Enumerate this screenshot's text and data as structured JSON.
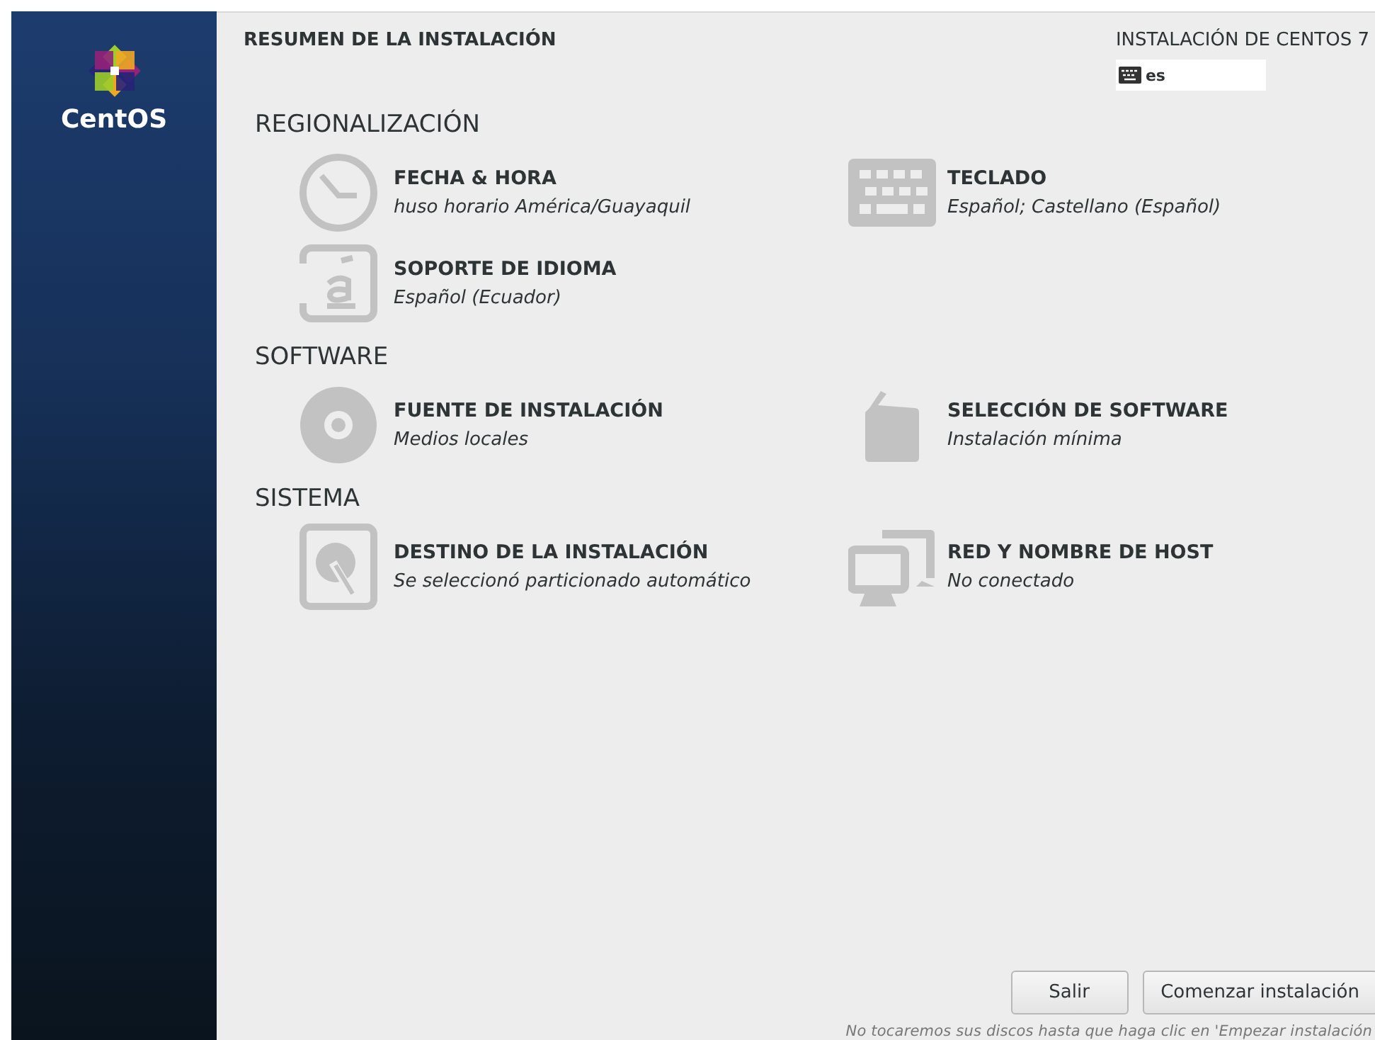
{
  "sidebar": {
    "logo_text": "CentOS"
  },
  "header": {
    "title": "RESUMEN DE LA INSTALACIÓN",
    "product": "INSTALACIÓN DE CENTOS 7",
    "keyboard_layout": "es"
  },
  "sections": [
    {
      "title": "REGIONALIZACIÓN",
      "spokes": [
        {
          "kind": "clock",
          "title": "FECHA & HORA",
          "status": "huso horario América/Guayaquil"
        },
        {
          "kind": "keyboard",
          "title": "TECLADO",
          "status": "Español; Castellano (Español)"
        },
        {
          "kind": "language",
          "title": "SOPORTE DE IDIOMA",
          "status": "Español (Ecuador)"
        }
      ]
    },
    {
      "title": "SOFTWARE",
      "spokes": [
        {
          "kind": "disc",
          "title": "FUENTE DE INSTALACIÓN",
          "status": "Medios locales"
        },
        {
          "kind": "package",
          "title": "SELECCIÓN DE SOFTWARE",
          "status": "Instalación mínima"
        }
      ]
    },
    {
      "title": "SISTEMA",
      "spokes": [
        {
          "kind": "harddisk",
          "title": "DESTINO DE LA INSTALACIÓN",
          "status": "Se seleccionó particionado automático"
        },
        {
          "kind": "network",
          "title": "RED Y NOMBRE DE HOST",
          "status": "No conectado"
        }
      ]
    }
  ],
  "buttons": [
    {
      "label": "Salir"
    },
    {
      "label": "Comenzar instalación"
    }
  ],
  "footer_note": "No tocaremos sus discos hasta que haga clic en 'Empezar instalación"
}
